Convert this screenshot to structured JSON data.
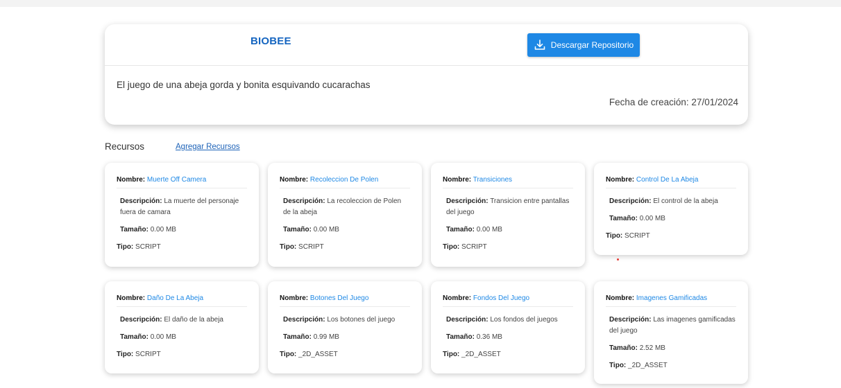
{
  "header": {
    "title": "BIOBEE",
    "download_label": "Descargar Repositorio",
    "description": "El juego de una abeja gorda y bonita esquivando cucarachas",
    "date_label": "Fecha de creación:",
    "date_value": "27/01/2024"
  },
  "resources": {
    "title": "Recursos",
    "add_label": "Agregar Recursos",
    "field_labels": {
      "name": "Nombre:",
      "description": "Descripción:",
      "size": "Tamaño:",
      "type": "Tipo:"
    },
    "items": [
      {
        "name": "Muerte Off Camera",
        "description": "La muerte del personaje fuera de camara",
        "size": "0.00 MB",
        "type": "SCRIPT"
      },
      {
        "name": "Recoleccion De Polen",
        "description": "La recoleccion de Polen de la abeja",
        "size": "0.00 MB",
        "type": "SCRIPT"
      },
      {
        "name": "Transiciones",
        "description": "Transicion entre pantallas del juego",
        "size": "0.00 MB",
        "type": "SCRIPT"
      },
      {
        "name": "Control De La Abeja",
        "description": "El control de la abeja",
        "size": "0.00 MB",
        "type": "SCRIPT"
      },
      {
        "name": "Daño De La Abeja",
        "description": "El daño de la abeja",
        "size": "0.00 MB",
        "type": "SCRIPT"
      },
      {
        "name": "Botones Del Juego",
        "description": "Los botones del juego",
        "size": "0.99 MB",
        "type": "_2D_ASSET"
      },
      {
        "name": "Fondos Del Juego",
        "description": "Los fondos del juegos",
        "size": "0.36 MB",
        "type": "_2D_ASSET"
      },
      {
        "name": "Imagenes Gamificadas",
        "description": "Las imagenes gamificadas del juego",
        "size": "2.52 MB",
        "type": "_2D_ASSET"
      }
    ]
  },
  "colors": {
    "primary": "#1e88e5",
    "brand": "#1565c0",
    "link": "#1e63b8"
  },
  "icons": {
    "download": "download-icon"
  }
}
